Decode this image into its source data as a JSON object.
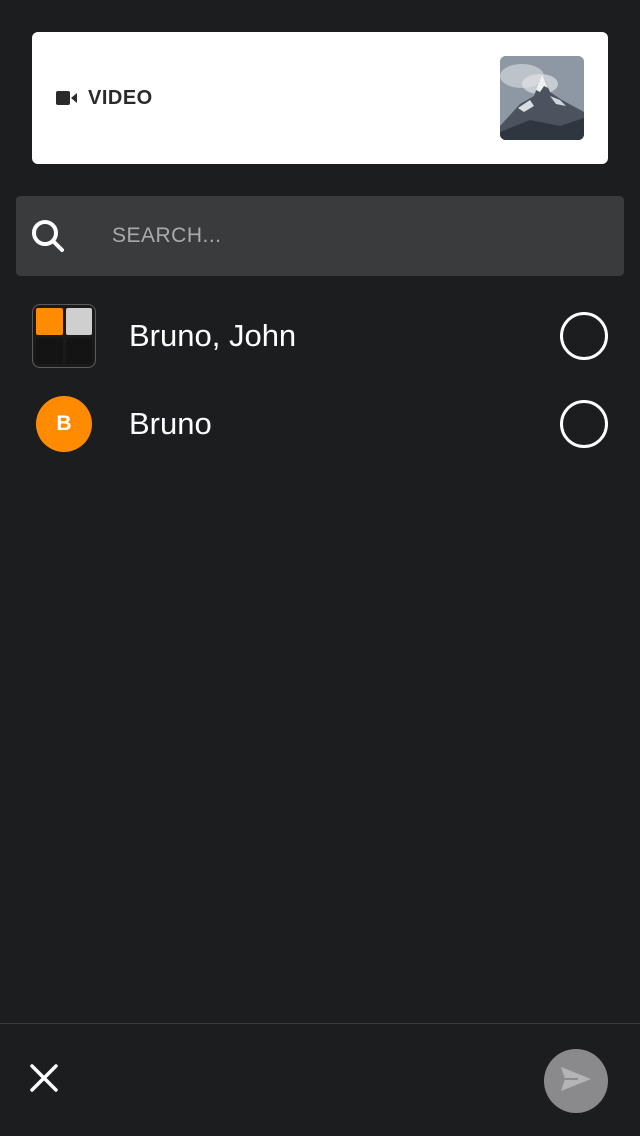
{
  "media": {
    "type_label": "VIDEO",
    "type_icon": "video-camera-icon",
    "thumbnail": "mountain-landscape-thumbnail"
  },
  "search": {
    "placeholder": "SEARCH...",
    "value": "",
    "icon": "search-icon"
  },
  "contacts": [
    {
      "name": "Bruno, John",
      "avatar_type": "group",
      "selected": false
    },
    {
      "name": "Bruno",
      "avatar_type": "letter",
      "avatar_letter": "B",
      "avatar_color": "#ff8c00",
      "selected": false
    }
  ],
  "footer": {
    "close_icon": "close-icon",
    "send_icon": "send-icon",
    "send_enabled": false
  },
  "colors": {
    "background": "#1c1d1f",
    "search_background": "#3a3b3d",
    "accent": "#ff8c00",
    "send_disabled": "#8a8a8c"
  }
}
